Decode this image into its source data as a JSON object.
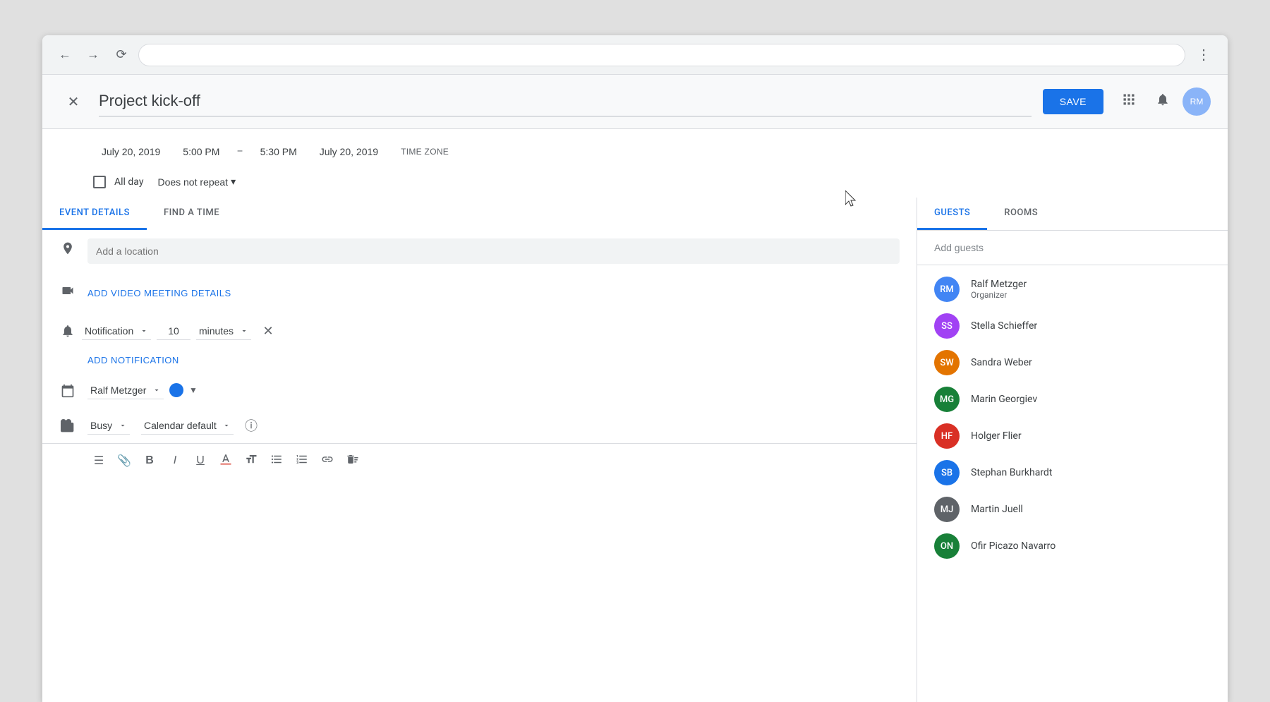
{
  "browser": {
    "address": "",
    "menu_icon": "⋮"
  },
  "header": {
    "title": "Project kick-off",
    "save_label": "SAVE",
    "apps_icon": "apps",
    "notifications_icon": "notifications",
    "close_icon": "×"
  },
  "datetime": {
    "start_date": "July 20, 2019",
    "start_time": "5:00 PM",
    "end_time": "5:30 PM",
    "end_date": "July 20, 2019",
    "timezone_label": "TIME ZONE",
    "separator": "–"
  },
  "allday": {
    "label": "All day",
    "repeat_label": "Does not repeat",
    "repeat_arrow": "▾"
  },
  "tabs": {
    "left": [
      {
        "id": "event-details",
        "label": "EVENT DETAILS"
      },
      {
        "id": "find-a-time",
        "label": "FIND A TIME"
      }
    ],
    "right": [
      {
        "id": "guests",
        "label": "GUESTS"
      },
      {
        "id": "rooms",
        "label": "ROOMS"
      }
    ]
  },
  "form": {
    "location_placeholder": "Add a location",
    "video_meeting_label": "ADD VIDEO MEETING DETAILS",
    "notification": {
      "type": "Notification",
      "value": "10",
      "unit": "minutes"
    },
    "add_notification_label": "ADD NOTIFICATION",
    "calendar": {
      "owner": "Ralf Metzger",
      "color": "#1a73e8"
    },
    "status": {
      "status_value": "Busy",
      "visibility_value": "Calendar default"
    }
  },
  "guests": {
    "add_placeholder": "Add guests",
    "list": [
      {
        "name": "Ralf Metzger",
        "role": "Organizer",
        "color": "#4285f4",
        "initials": "RM"
      },
      {
        "name": "Stella Schieffer",
        "role": "",
        "color": "#a142f4",
        "initials": "SS"
      },
      {
        "name": "Sandra Weber",
        "role": "",
        "color": "#e37400",
        "initials": "SW"
      },
      {
        "name": "Marin Georgiev",
        "role": "",
        "color": "#188038",
        "initials": "MG"
      },
      {
        "name": "Holger Flier",
        "role": "",
        "color": "#d93025",
        "initials": "HF"
      },
      {
        "name": "Stephan Burkhardt",
        "role": "",
        "color": "#1a73e8",
        "initials": "SB"
      },
      {
        "name": "Martin Juell",
        "role": "",
        "color": "#5f6368",
        "initials": "MJ"
      },
      {
        "name": "Ofir Picazo Navarro",
        "role": "",
        "color": "#188038",
        "initials": "ON"
      }
    ]
  },
  "toolbar": {
    "description_icon": "≡",
    "attach_icon": "📎",
    "bold_icon": "B",
    "italic_icon": "I",
    "underline_icon": "U",
    "font_color_icon": "A",
    "font_size_icon": "T↑",
    "list_icon": "≡",
    "numlist_icon": "1≡",
    "link_icon": "🔗",
    "remove_format_icon": "✕"
  },
  "colors": {
    "accent": "#1a73e8",
    "tab_indicator": "#1a73e8",
    "icon": "#5f6368",
    "text_primary": "#3c4043",
    "text_secondary": "#5f6368",
    "border": "#dadce0",
    "bg_input": "#f1f3f4"
  }
}
